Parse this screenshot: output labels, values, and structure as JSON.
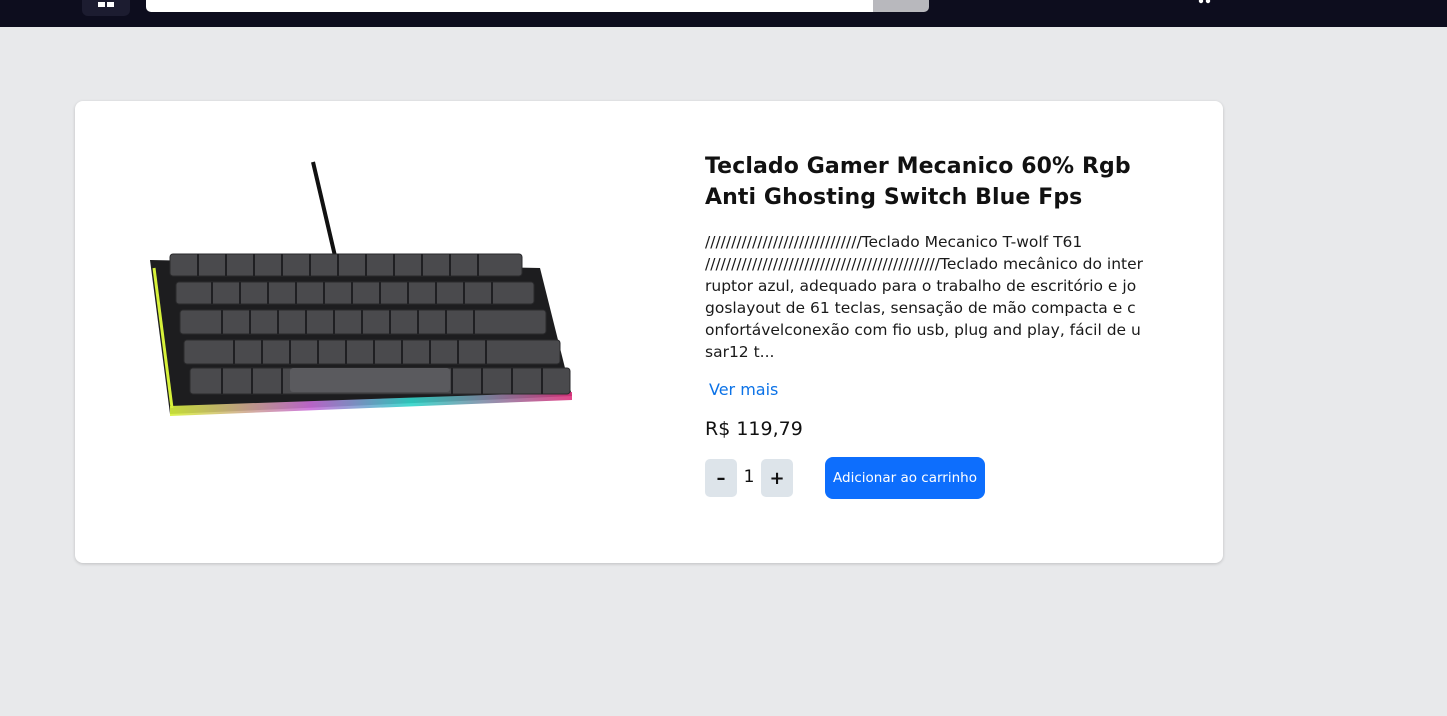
{
  "header": {
    "menu_icon": "grid-icon",
    "search_placeholder": "",
    "cart_icon": "cart-icon"
  },
  "product": {
    "image_icon": "keyboard-image",
    "title": "Teclado Gamer Mecanico 60% Rgb Anti Ghosting Switch Blue Fps",
    "description": "//////////////////////////////Teclado Mecanico T-wolf T61 /////////////////////////////////////////////Teclado mecânico do interruptor azul, adequado para o trabalho de escritório e jogoslayout de 61 teclas, sensação de mão compacta e confortávelconexão com fio usb, plug and play, fácil de usar12 t...",
    "see_more_label": "Ver mais",
    "price": "R$ 119,79",
    "quantity": "1",
    "minus_label": "–",
    "plus_label": "+",
    "add_to_cart_label": "Adicionar ao carrinho"
  },
  "colors": {
    "topbar": "#0d0d1e",
    "background": "#e8e9eb",
    "accent": "#0d6efd",
    "link": "#0b72e7"
  }
}
